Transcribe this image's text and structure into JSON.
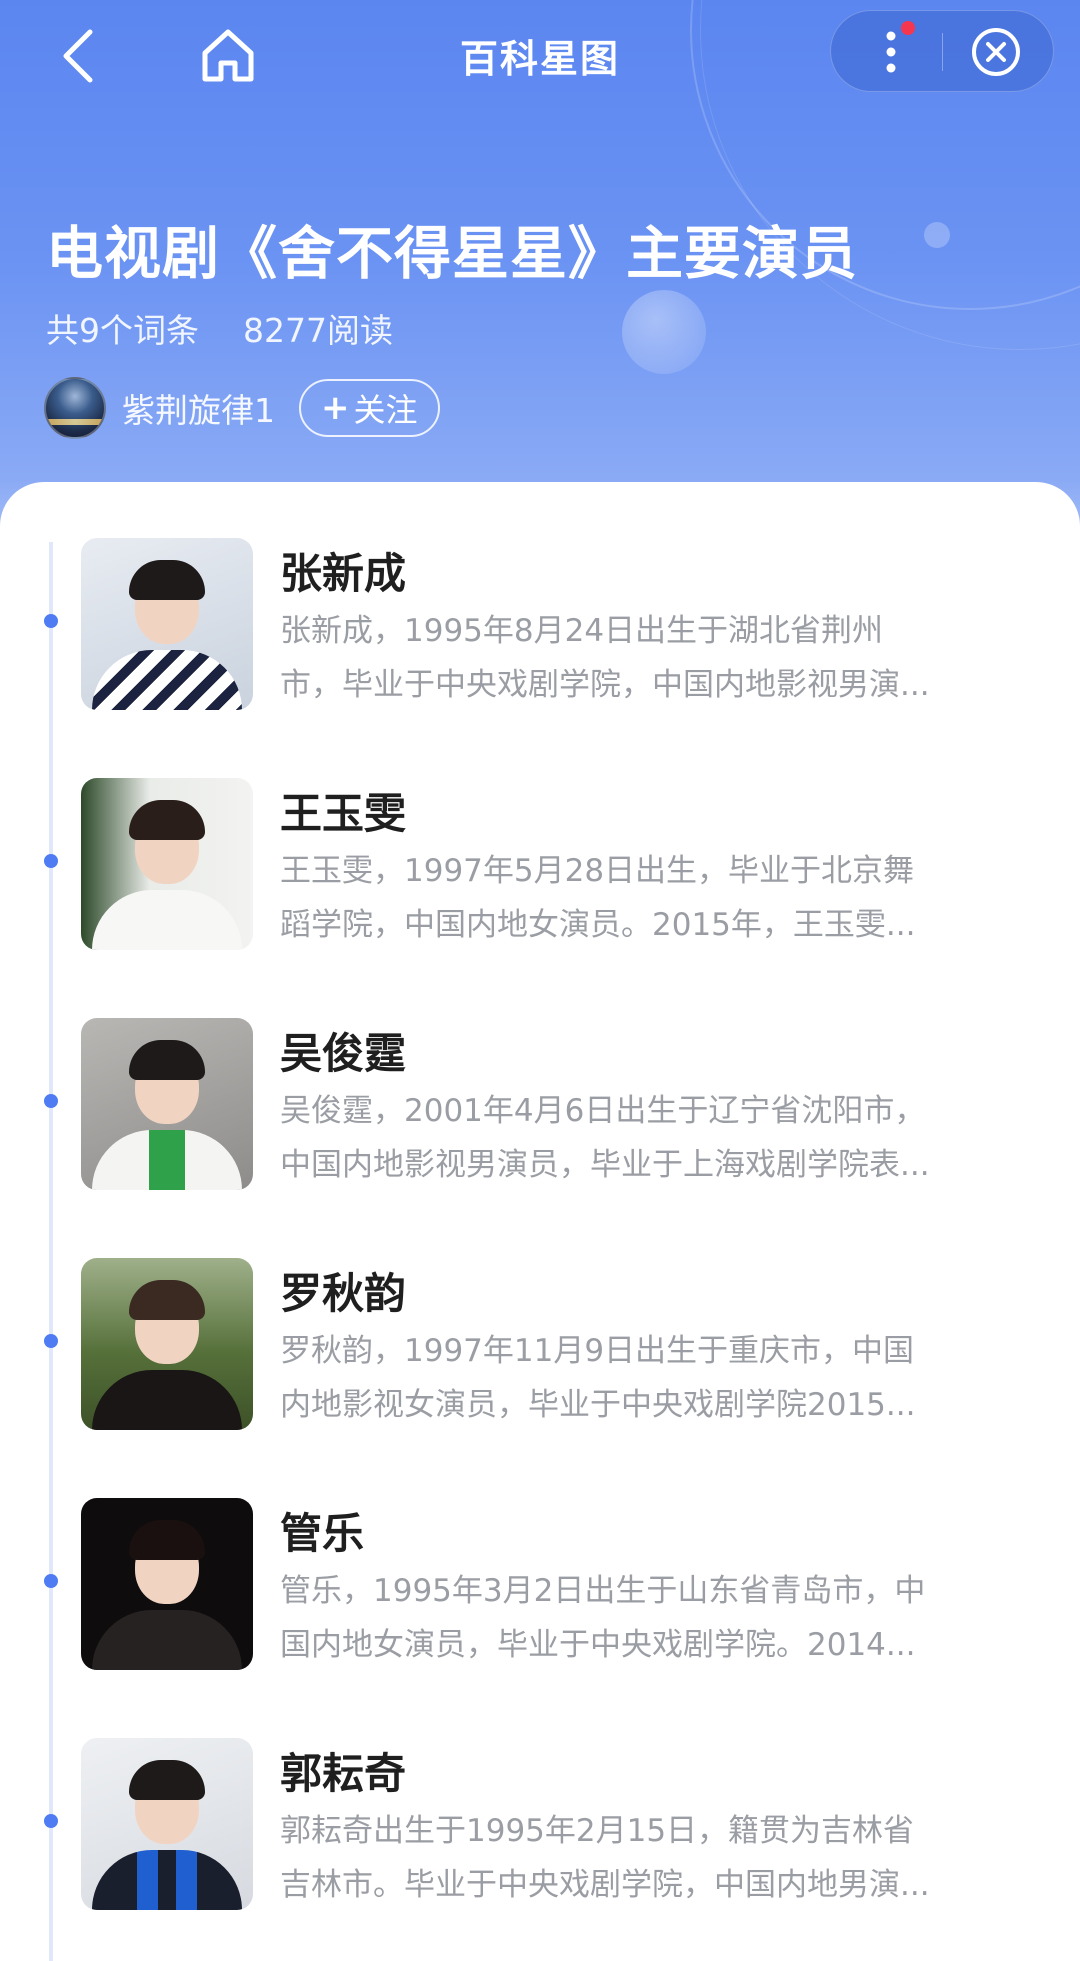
{
  "nav": {
    "title": "百科星图"
  },
  "header": {
    "title": "电视剧《舍不得星星》主要演员",
    "entry_count": "共9个词条",
    "read_count": "8277阅读",
    "author_name": "紫荆旋律1",
    "follow_label": "关注"
  },
  "items": [
    {
      "name": "张新成",
      "line1": "张新成，1995年8月24日出生于湖北省荆州",
      "line2": "市，毕业于中央戏剧学院，中国内地影视男演..."
    },
    {
      "name": "王玉雯",
      "line1": "王玉雯，1997年5月28日出生，毕业于北京舞",
      "line2": "蹈学院，中国内地女演员。2015年，王玉雯..."
    },
    {
      "name": "吴俊霆",
      "line1": "吴俊霆，2001年4月6日出生于辽宁省沈阳市，",
      "line2": "中国内地影视男演员，毕业于上海戏剧学院表..."
    },
    {
      "name": "罗秋韵",
      "line1": "罗秋韵，1997年11月9日出生于重庆市，中国",
      "line2": "内地影视女演员，毕业于中央戏剧学院2015..."
    },
    {
      "name": "管乐",
      "line1": "管乐，1995年3月2日出生于山东省青岛市，中",
      "line2": "国内地女演员，毕业于中央戏剧学院。2014..."
    },
    {
      "name": "郭耘奇",
      "line1": "郭耘奇出生于1995年2月15日，籍贯为吉林省",
      "line2": "吉林市。毕业于中央戏剧学院，中国内地男演..."
    }
  ],
  "colors": {
    "header_gradient_top": "#5b86f0",
    "accent": "#4f7cf2",
    "notification_dot": "#f5364f",
    "title_text": "#1f1f1f",
    "desc_text": "#9a9da3"
  },
  "icons": {
    "back": "chevron-left-icon",
    "home": "home-icon",
    "more": "more-vertical-icon",
    "close": "close-circle-icon",
    "follow": "plus-icon"
  }
}
